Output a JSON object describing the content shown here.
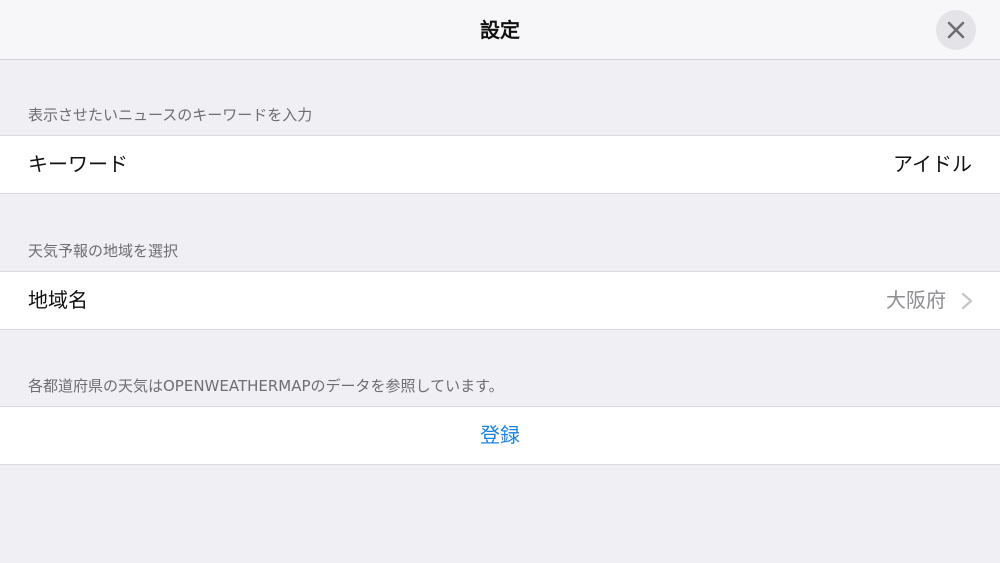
{
  "navbar": {
    "title": "設定",
    "close_icon": "close-icon"
  },
  "keyword_section": {
    "header": "表示させたいニュースのキーワードを入力",
    "label": "キーワード",
    "value": "アイドル"
  },
  "region_section": {
    "header": "天気予報の地域を選択",
    "label": "地域名",
    "value": "大阪府",
    "chevron_icon": "chevron-right-icon"
  },
  "register_section": {
    "header": "各都道府県の天気はOPENWEATHERMAPのデータを参照しています。",
    "button_label": "登録"
  },
  "colors": {
    "background": "#efeff4",
    "accent": "#1a82e2",
    "secondary_text": "#8e8e93"
  }
}
